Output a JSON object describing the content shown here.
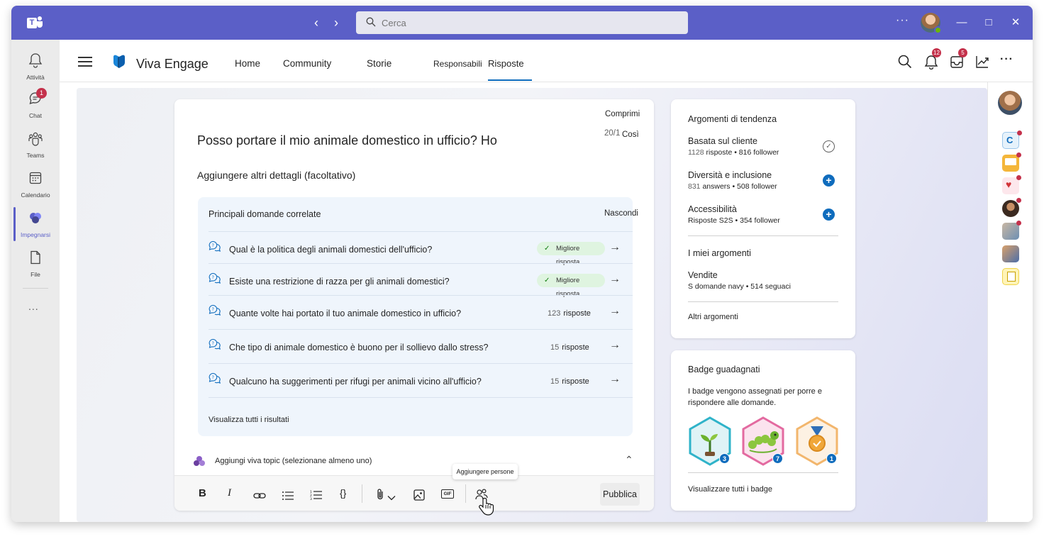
{
  "search": {
    "placeholder": "Cerca",
    "value": "Cerca"
  },
  "rail": {
    "items": [
      {
        "label": "Attività",
        "icon": "bell-icon"
      },
      {
        "label": "Chat",
        "icon": "chat-icon",
        "badge": "1"
      },
      {
        "label": "Teams",
        "icon": "teams-icon"
      },
      {
        "label": "Calendario",
        "icon": "calendar-icon"
      },
      {
        "label": "Impegnarsi",
        "icon": "viva-engage-icon"
      },
      {
        "label": "File",
        "icon": "file-icon"
      }
    ],
    "more": "..."
  },
  "appbar": {
    "title": "Viva Engage",
    "tabs": [
      "Home",
      "Community",
      "Storie",
      "Responsabili",
      "Risposte"
    ],
    "notifications_badge": "12",
    "inbox_badge": "5"
  },
  "question": {
    "collapse_label": "Comprimi",
    "counter": "20/1",
    "counter_suffix": "Così",
    "title": "Posso portare il mio animale domestico in ufficio? Ho",
    "details_placeholder": "Aggiungere altri dettagli (facoltativo)",
    "related": {
      "heading": "Principali domande correlate",
      "hide_label": "Nascondi",
      "items": [
        {
          "text": "Qual è la politica degli animali domestici dell'ufficio?",
          "best": "Migliore risposta"
        },
        {
          "text": "Esiste una restrizione di razza per gli animali domestici?",
          "best": "Migliore risposta"
        },
        {
          "text": "Quante volte hai portato il tuo animale domestico in ufficio?",
          "count": "123",
          "count_label": "risposte"
        },
        {
          "text": "Che tipo di animale domestico è buono per il sollievo dallo stress?",
          "count": "15",
          "count_label": "risposte"
        },
        {
          "text": "Qualcuno ha suggerimenti per rifugi per animali vicino all'ufficio?",
          "count": "15",
          "count_label": "risposte"
        }
      ],
      "see_all": "Visualizza tutti i risultati"
    },
    "topic_add_label": "Aggiungi viva topic (selezionane almeno uno)",
    "tooltip": "Aggiungere persone",
    "toolbar": {
      "bold": "B",
      "italic": "I",
      "gif": "GIF",
      "publish": "Pubblica"
    }
  },
  "trending": {
    "title": "Argomenti di tendenza",
    "items": [
      {
        "name": "Basata sul cliente",
        "count": "1128",
        "stats": "risposte • 816 follower",
        "action": "following"
      },
      {
        "name": "Diversità e inclusione",
        "count": "831",
        "stats": "answers • 508 follower",
        "action": "follow"
      },
      {
        "name": "Accessibilità",
        "count": "",
        "stats": "Risposte S2S • 354 follower",
        "action": "follow"
      }
    ],
    "my_topics_title": "I miei argomenti",
    "my_topic": {
      "name": "Vendite",
      "stats": "S domande navy • 514 seguaci"
    },
    "more_topics": "Altri argomenti"
  },
  "badges": {
    "title": "Badge guadagnati",
    "description": "I badge vengono assegnati per porre e rispondere alle domande.",
    "items": [
      {
        "icon": "sprout-badge-icon",
        "count": "3"
      },
      {
        "icon": "caterpillar-badge-icon",
        "count": "7"
      },
      {
        "icon": "medal-badge-icon",
        "count": "1"
      }
    ],
    "see_all": "Visualizzare tutti i badge"
  },
  "colors": {
    "teams_purple": "#5b5fc7",
    "accent_blue": "#0f6cbd",
    "badge_red": "#c4314b",
    "related_bg": "#eff5fc"
  }
}
